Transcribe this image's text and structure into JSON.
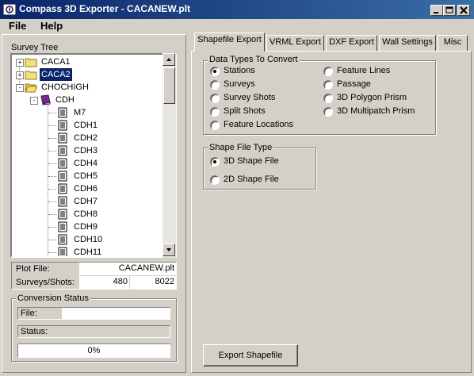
{
  "window": {
    "title": "Compass 3D Exporter - CACANEW.plt",
    "controls": {
      "minimize": "_",
      "maximize": "□",
      "close": "×"
    }
  },
  "menu": {
    "items": [
      "File",
      "Help"
    ]
  },
  "survey_tree": {
    "label": "Survey Tree",
    "nodes": [
      {
        "label": "CACA1",
        "level": 0,
        "expander": "+",
        "icon": "folder-icon",
        "selected": false
      },
      {
        "label": "CACA2",
        "level": 0,
        "expander": "+",
        "icon": "folder-icon",
        "selected": true
      },
      {
        "label": "CHOCHIGH",
        "level": 0,
        "expander": "-",
        "icon": "folder-open-icon",
        "selected": false
      },
      {
        "label": "CDH",
        "level": 1,
        "expander": "-",
        "icon": "book-icon",
        "selected": false
      },
      {
        "label": "M7",
        "level": 2,
        "icon": "document-icon"
      },
      {
        "label": "CDH1",
        "level": 2,
        "icon": "document-icon"
      },
      {
        "label": "CDH2",
        "level": 2,
        "icon": "document-icon"
      },
      {
        "label": "CDH3",
        "level": 2,
        "icon": "document-icon"
      },
      {
        "label": "CDH4",
        "level": 2,
        "icon": "document-icon"
      },
      {
        "label": "CDH5",
        "level": 2,
        "icon": "document-icon"
      },
      {
        "label": "CDH6",
        "level": 2,
        "icon": "document-icon"
      },
      {
        "label": "CDH7",
        "level": 2,
        "icon": "document-icon"
      },
      {
        "label": "CDH8",
        "level": 2,
        "icon": "document-icon"
      },
      {
        "label": "CDH9",
        "level": 2,
        "icon": "document-icon"
      },
      {
        "label": "CDH10",
        "level": 2,
        "icon": "document-icon"
      },
      {
        "label": "CDH11",
        "level": 2,
        "icon": "document-icon"
      }
    ]
  },
  "info": {
    "plot_file_label": "Plot File:",
    "plot_file_value": "CACANEW.plt",
    "surveys_shots_label": "Surveys/Shots:",
    "surveys_value": "480",
    "shots_value": "8022"
  },
  "conversion_status": {
    "title": "Conversion Status",
    "file_label": "File:",
    "file_value": "",
    "status_label": "Status:",
    "status_value": "",
    "progress_text": "0%",
    "progress": 0
  },
  "tabs": [
    {
      "label": "Shapefile Export",
      "active": true
    },
    {
      "label": "VRML Export",
      "active": false
    },
    {
      "label": "DXF Export",
      "active": false
    },
    {
      "label": "Wall Settings",
      "active": false
    },
    {
      "label": "Misc",
      "active": false
    }
  ],
  "data_types": {
    "title": "Data Types To Convert",
    "options": [
      {
        "label": "Stations",
        "checked": true
      },
      {
        "label": "Surveys",
        "checked": false
      },
      {
        "label": "Survey Shots",
        "checked": false
      },
      {
        "label": "Split Shots",
        "checked": false
      },
      {
        "label": "Feature Locations",
        "checked": false
      },
      {
        "label": "Feature Lines",
        "checked": false
      },
      {
        "label": "Passage",
        "checked": false
      },
      {
        "label": "3D Polygon Prism",
        "checked": false
      },
      {
        "label": "3D Multipatch Prism",
        "checked": false
      }
    ]
  },
  "shape_file_type": {
    "title": "Shape File Type",
    "options": [
      {
        "label": "3D Shape File",
        "checked": true
      },
      {
        "label": "2D Shape File",
        "checked": false
      }
    ]
  },
  "export_button": {
    "label": "Export Shapefile"
  },
  "colors": {
    "title_start": "#0a246a",
    "title_end": "#3a6ea5",
    "selection": "#0a246a",
    "folder": "#f7e07a",
    "book": "#7a2a8a",
    "face": "#d4d0c8"
  }
}
